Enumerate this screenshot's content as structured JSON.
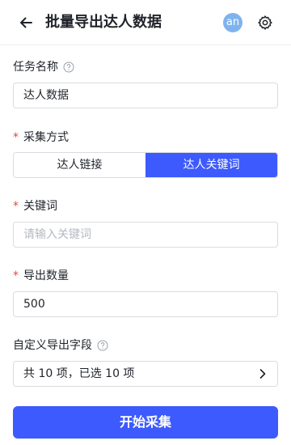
{
  "header": {
    "title": "批量导出达人数据",
    "avatar_text": "an",
    "icons": {
      "back": "arrow-left-icon",
      "settings": "gear-icon"
    }
  },
  "task_name": {
    "label": "任务名称",
    "value": "达人数据"
  },
  "collect_method": {
    "label": "采集方式",
    "required": true,
    "options": [
      "达人链接",
      "达人关键词"
    ],
    "selected": "达人关键词"
  },
  "keyword": {
    "label": "关键词",
    "required": true,
    "placeholder": "请输入关键词",
    "value": ""
  },
  "export_count": {
    "label": "导出数量",
    "required": true,
    "value": "500"
  },
  "custom_fields": {
    "label": "自定义导出字段",
    "summary": "共 10 项，已选 10 项"
  },
  "start_button": {
    "label": "开始采集"
  },
  "colors": {
    "primary": "#3d5afe",
    "required": "#e8453c",
    "avatar": "#7fb3ee",
    "border": "#d9dce1"
  }
}
